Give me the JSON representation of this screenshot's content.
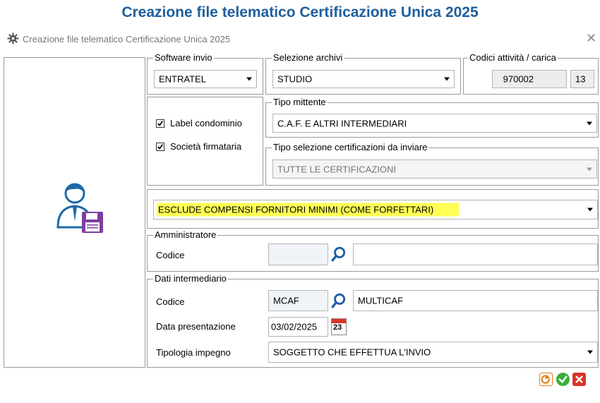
{
  "page": {
    "title": "Creazione file telematico Certificazione Unica 2025"
  },
  "window": {
    "title": "Creazione file telematico Certificazione Unica 2025",
    "close_icon": "close-icon"
  },
  "software_invio": {
    "legend": "Software invio",
    "value": "ENTRATEL"
  },
  "selezione_archivi": {
    "legend": "Selezione archivi",
    "value": "STUDIO"
  },
  "codici_attivita": {
    "legend": "Codici attività / carica",
    "codice": "970002",
    "carica": "13"
  },
  "checkboxes": [
    {
      "label": "Label condominio",
      "checked": true
    },
    {
      "label": "Società firmataria",
      "checked": true
    }
  ],
  "tipo_mittente": {
    "legend": "Tipo mittente",
    "value": "C.A.F. E ALTRI INTERMEDIARI"
  },
  "tipo_selezione": {
    "legend": "Tipo selezione certificazioni da inviare",
    "value": "TUTTE LE CERTIFICAZIONI"
  },
  "esclusione": {
    "value": "ESCLUDE COMPENSI FORNITORI MINIMI (COME FORFETTARI)",
    "highlight": "#ffff55"
  },
  "amministratore": {
    "legend": "Amministratore",
    "codice_label": "Codice",
    "codice": "",
    "descrizione": ""
  },
  "intermediario": {
    "legend": "Dati intermediario",
    "codice_label": "Codice",
    "codice": "MCAF",
    "descrizione": "MULTICAF",
    "data_label": "Data presentazione",
    "data": "03/02/2025",
    "calendar_day": "23",
    "tipologia_label": "Tipologia impegno",
    "tipologia": "SOGGETTO CHE EFFETTUA L'INVIO"
  },
  "colors": {
    "title": "#1f5f9e",
    "confirm": "#3cae3c",
    "cancel": "#d9342b",
    "export": "#f08a24",
    "save_icon": "#7b3f9e"
  }
}
